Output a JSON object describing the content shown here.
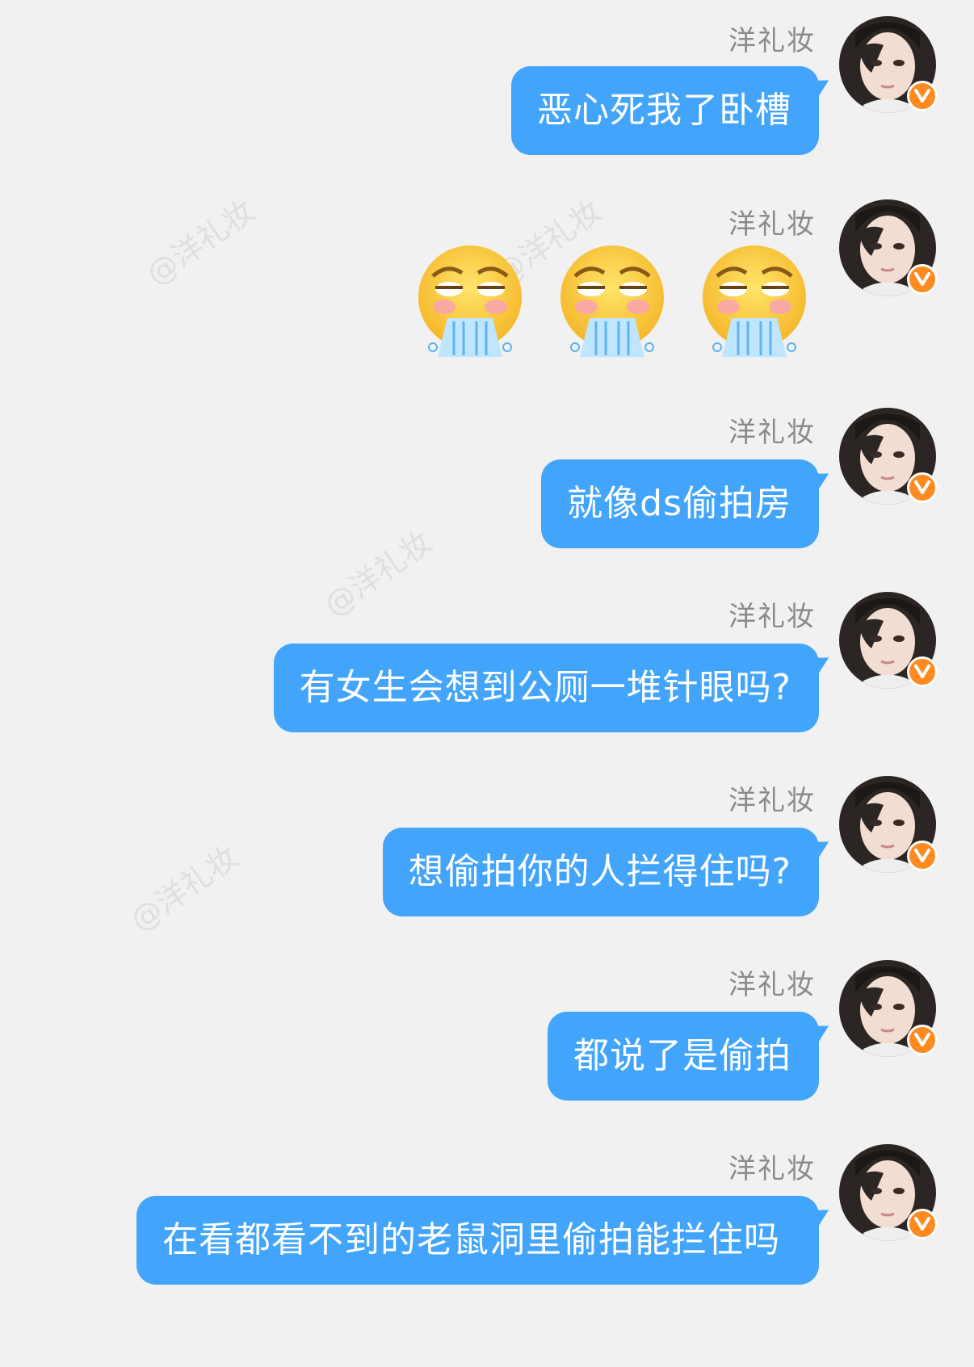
{
  "watermark": "@洋礼妆",
  "messages": [
    {
      "sender": "洋礼妆",
      "type": "text",
      "text": "恶心死我了卧槽"
    },
    {
      "sender": "洋礼妆",
      "type": "emoji",
      "emoji": [
        "vomit-emoji",
        "vomit-emoji",
        "vomit-emoji"
      ]
    },
    {
      "sender": "洋礼妆",
      "type": "text",
      "text": "就像ds偷拍房"
    },
    {
      "sender": "洋礼妆",
      "type": "text",
      "text": "有女生会想到公厕一堆针眼吗?"
    },
    {
      "sender": "洋礼妆",
      "type": "text",
      "text": "想偷拍你的人拦得住吗?"
    },
    {
      "sender": "洋礼妆",
      "type": "text",
      "text": "都说了是偷拍"
    },
    {
      "sender": "洋礼妆",
      "type": "text",
      "text": "在看都看不到的老鼠洞里偷拍能拦住吗"
    }
  ],
  "colors": {
    "bubble": "#42a5fb",
    "badge": "#ff8a1f",
    "background": "#f1f1f1"
  }
}
